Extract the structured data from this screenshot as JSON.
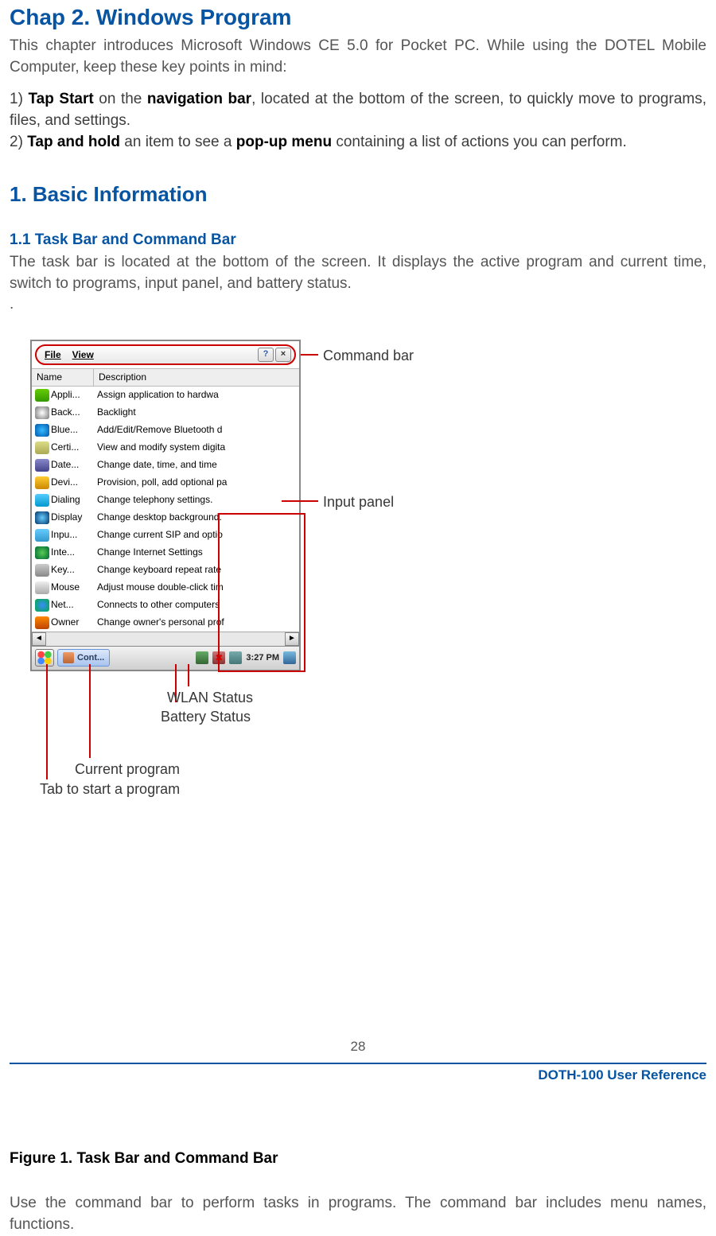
{
  "chapter_title": "Chap 2. Windows Program",
  "intro": "This chapter introduces Microsoft Windows CE 5.0 for Pocket PC. While using the DOTEL Mobile Computer, keep these key points in mind:",
  "item1_pre": "1) ",
  "item1_b1": "Tap Start",
  "item1_mid": " on the ",
  "item1_b2": "navigation bar",
  "item1_post": ", located at the bottom of the screen, to quickly move to programs, files, and settings.",
  "item2_pre": "2) ",
  "item2_b1": "Tap and hold",
  "item2_mid": " an item to see a ",
  "item2_b2": "pop-up menu",
  "item2_post": " containing a list of actions you can perform.",
  "h1": "1. Basic Information",
  "h2": "1.1 Task Bar and Command Bar",
  "para1": "The task bar is located at the bottom of the screen. It displays the active program and current time, switch to programs, input panel, and battery status.",
  "dot": ".",
  "shot": {
    "menu_file": "File",
    "menu_view": "View",
    "help_glyph": "?",
    "close_glyph": "×",
    "col_name": "Name",
    "col_desc": "Description",
    "rows": [
      {
        "ic": "ic-appli",
        "n": "Appli...",
        "d": "Assign application to hardwa"
      },
      {
        "ic": "ic-back",
        "n": "Back...",
        "d": "Backlight"
      },
      {
        "ic": "ic-blue",
        "n": "Blue...",
        "d": "Add/Edit/Remove Bluetooth d"
      },
      {
        "ic": "ic-cert",
        "n": "Certi...",
        "d": "View and modify system digita"
      },
      {
        "ic": "ic-date",
        "n": "Date...",
        "d": "Change date, time, and time"
      },
      {
        "ic": "ic-devi",
        "n": "Devi...",
        "d": "Provision, poll, add optional pa"
      },
      {
        "ic": "ic-dial",
        "n": "Dialing",
        "d": "Change telephony settings."
      },
      {
        "ic": "ic-disp",
        "n": "Display",
        "d": "Change desktop background."
      },
      {
        "ic": "ic-inpu",
        "n": "Inpu...",
        "d": "Change current SIP and optio"
      },
      {
        "ic": "ic-inte",
        "n": "Inte...",
        "d": "Change Internet Settings"
      },
      {
        "ic": "ic-key",
        "n": "Key...",
        "d": "Change keyboard repeat rate"
      },
      {
        "ic": "ic-mouse",
        "n": "Mouse",
        "d": "Adjust mouse double-click tim"
      },
      {
        "ic": "ic-net",
        "n": "Net...",
        "d": "Connects to other computers"
      },
      {
        "ic": "ic-owner",
        "n": "Owner",
        "d": "Change owner's personal prof"
      }
    ],
    "scroll_left": "◄",
    "scroll_right": "►",
    "task_btn": "Cont...",
    "clock": "3:27 PM"
  },
  "ann": {
    "command_bar": "Command bar",
    "input_panel": "Input panel",
    "wlan": "WLAN Status",
    "battery": "Battery Status",
    "current": "Current program",
    "tabstart": "Tab to start a program"
  },
  "figure": "Figure 1. Task Bar and Command Bar",
  "para2": "Use the command bar to perform tasks in programs. The command bar includes menu names, functions.",
  "page_no": "28",
  "footer": "DOTH-100 User Reference"
}
